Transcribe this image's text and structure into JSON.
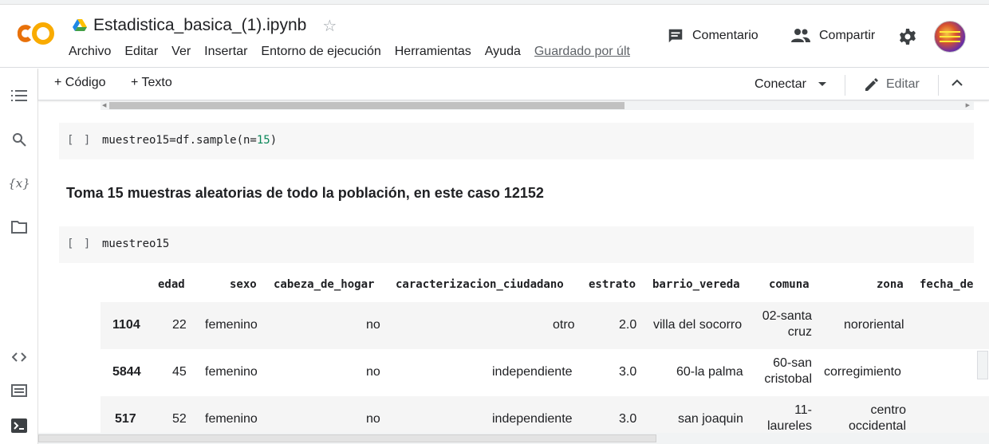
{
  "header": {
    "notebook_title": "Estadistica_basica_(1).ipynb",
    "menu": [
      "Archivo",
      "Editar",
      "Ver",
      "Insertar",
      "Entorno de ejecución",
      "Herramientas",
      "Ayuda"
    ],
    "saved_status": "Guardado por últ",
    "comment_label": "Comentario",
    "share_label": "Compartir",
    "logo_text": "CO"
  },
  "toolbar": {
    "add_code": "+ Código",
    "add_text": "+ Texto",
    "connect": "Conectar",
    "edit": "Editar"
  },
  "sidebar": {
    "items": [
      "table-of-contents-icon",
      "search-icon",
      "variables-icon",
      "files-icon",
      "code-snippets-icon",
      "command-palette-icon",
      "terminal-icon"
    ],
    "variables_label": "{x}"
  },
  "cells": [
    {
      "bracket": "[ ]",
      "code_prefix": "muestreo15=df.sample(n=",
      "code_number": "15",
      "code_suffix": ")"
    },
    {
      "bracket": "[ ]",
      "code": "muestreo15"
    }
  ],
  "markdown": "Toma 15 muestras aleatorias de todo la población, en este caso 12152",
  "dataframe": {
    "columns": [
      "edad",
      "sexo",
      "cabeza_de_hogar",
      "caracterizacion_ciudadano",
      "estrato",
      "barrio_vereda",
      "comuna",
      "zona",
      "fecha_de"
    ],
    "rows": [
      {
        "index": "1104",
        "edad": "22",
        "sexo": "femenino",
        "cabeza_de_hogar": "no",
        "caracterizacion_ciudadano": "otro",
        "estrato": "2.0",
        "barrio_vereda": "villa del socorro",
        "comuna_1": "02-santa",
        "comuna_2": "cruz",
        "zona_1": "nororiental",
        "zona_2": ""
      },
      {
        "index": "5844",
        "edad": "45",
        "sexo": "femenino",
        "cabeza_de_hogar": "no",
        "caracterizacion_ciudadano": "independiente",
        "estrato": "3.0",
        "barrio_vereda": "60-la palma",
        "comuna_1": "60-san",
        "comuna_2": "cristobal",
        "zona_1": "corregimiento",
        "zona_2": ""
      },
      {
        "index": "517",
        "edad": "52",
        "sexo": "femenino",
        "cabeza_de_hogar": "no",
        "caracterizacion_ciudadano": "independiente",
        "estrato": "3.0",
        "barrio_vereda": "san joaquin",
        "comuna_1": "11-",
        "comuna_2": "laureles",
        "zona_1": "centro",
        "zona_2": "occidental"
      }
    ]
  },
  "colors": {
    "accent_orange": "#F9AB00",
    "logo_dark_orange": "#E8710A",
    "code_number": "#098658"
  }
}
